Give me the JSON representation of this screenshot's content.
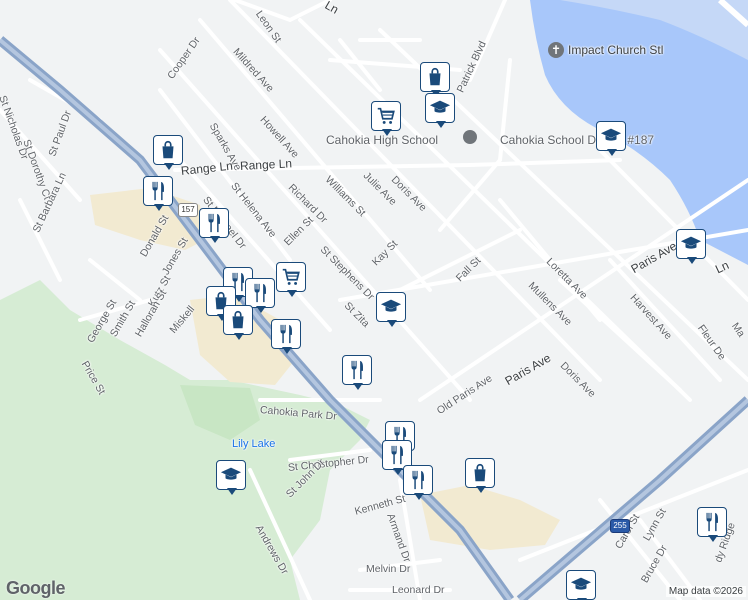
{
  "map": {
    "attribution": "Map data ©2026",
    "logo": "Google",
    "colors": {
      "land": "#f1f3f4",
      "park": "#d6ecd4",
      "water": "#a8c7fa",
      "highway": "#8aa4c8",
      "road": "#ffffff",
      "commercial": "#f2ead1",
      "pin_border": "#1a4a7a"
    }
  },
  "streets": [
    {
      "name": "Leon St"
    },
    {
      "name": "Mildred Ave"
    },
    {
      "name": "Cooper Dr"
    },
    {
      "name": "Howell Ave"
    },
    {
      "name": "Sparks Ave"
    },
    {
      "name": "Range Ln"
    },
    {
      "name": "Range Ln"
    },
    {
      "name": "St Helena Ave"
    },
    {
      "name": "Richard Dr"
    },
    {
      "name": "Williams St"
    },
    {
      "name": "Julie Ave"
    },
    {
      "name": "Doris Ave"
    },
    {
      "name": "St Michael Dr"
    },
    {
      "name": "Ellen St"
    },
    {
      "name": "St Stephens Dr"
    },
    {
      "name": "Kay St"
    },
    {
      "name": "Fall St"
    },
    {
      "name": "Loretta Ave"
    },
    {
      "name": "Mullens Ave"
    },
    {
      "name": "Harvest Ave"
    },
    {
      "name": "Paris Ave"
    },
    {
      "name": "Paris Ave"
    },
    {
      "name": "Doris Ave"
    },
    {
      "name": "Old Paris Ave"
    },
    {
      "name": "St Zita"
    },
    {
      "name": "Donald St"
    },
    {
      "name": "Jones St"
    },
    {
      "name": "Kutz St"
    },
    {
      "name": "Halloran St"
    },
    {
      "name": "Smith St"
    },
    {
      "name": "George St"
    },
    {
      "name": "Price St"
    },
    {
      "name": "Miskell"
    },
    {
      "name": "Cahokia Park Dr"
    },
    {
      "name": "St Christopher Dr"
    },
    {
      "name": "St John Dr"
    },
    {
      "name": "Kenneth St"
    },
    {
      "name": "Armand Dr"
    },
    {
      "name": "Andrews Dr"
    },
    {
      "name": "Melvin Dr"
    },
    {
      "name": "Leonard Dr"
    },
    {
      "name": "Carol St"
    },
    {
      "name": "Lynn St"
    },
    {
      "name": "Bruce Dr"
    },
    {
      "name": "dy Ridge"
    },
    {
      "name": "Fleur De"
    },
    {
      "name": "Ma"
    },
    {
      "name": "Ln"
    },
    {
      "name": "Patrick Blvd"
    },
    {
      "name": "St Nicholas Dr"
    },
    {
      "name": "St Dorothy Ct"
    },
    {
      "name": "St Paul Dr"
    },
    {
      "name": "St Barbara Ln"
    },
    {
      "name": "Ln"
    }
  ],
  "places": [
    {
      "name": "Impact Church Stl"
    },
    {
      "name": "Cahokia High School"
    },
    {
      "name": "Cahokia School District #187"
    },
    {
      "name": "Lily Lake"
    }
  ],
  "route_shields": [
    "157",
    "255"
  ],
  "markers": [
    {
      "type": "shopping",
      "icon": "shopping-bag-icon"
    },
    {
      "type": "grocery",
      "icon": "shopping-cart-icon"
    },
    {
      "type": "school",
      "icon": "graduation-cap-icon"
    },
    {
      "type": "school",
      "icon": "graduation-cap-icon"
    },
    {
      "type": "shopping",
      "icon": "shopping-bag-icon"
    },
    {
      "type": "restaurant",
      "icon": "fork-knife-icon"
    },
    {
      "type": "restaurant",
      "icon": "fork-knife-icon"
    },
    {
      "type": "school",
      "icon": "graduation-cap-icon"
    },
    {
      "type": "restaurant",
      "icon": "fork-knife-icon"
    },
    {
      "type": "grocery",
      "icon": "shopping-cart-icon"
    },
    {
      "type": "shopping",
      "icon": "shopping-bag-icon"
    },
    {
      "type": "restaurant",
      "icon": "fork-knife-icon"
    },
    {
      "type": "shopping",
      "icon": "shopping-bag-icon"
    },
    {
      "type": "restaurant",
      "icon": "fork-knife-icon"
    },
    {
      "type": "school",
      "icon": "graduation-cap-icon"
    },
    {
      "type": "restaurant",
      "icon": "fork-knife-icon"
    },
    {
      "type": "restaurant",
      "icon": "fork-knife-icon"
    },
    {
      "type": "restaurant",
      "icon": "fork-knife-icon"
    },
    {
      "type": "restaurant",
      "icon": "fork-knife-icon"
    },
    {
      "type": "shopping",
      "icon": "shopping-bag-icon"
    },
    {
      "type": "school",
      "icon": "graduation-cap-icon"
    },
    {
      "type": "school",
      "icon": "graduation-cap-icon"
    },
    {
      "type": "restaurant",
      "icon": "fork-knife-icon"
    }
  ]
}
